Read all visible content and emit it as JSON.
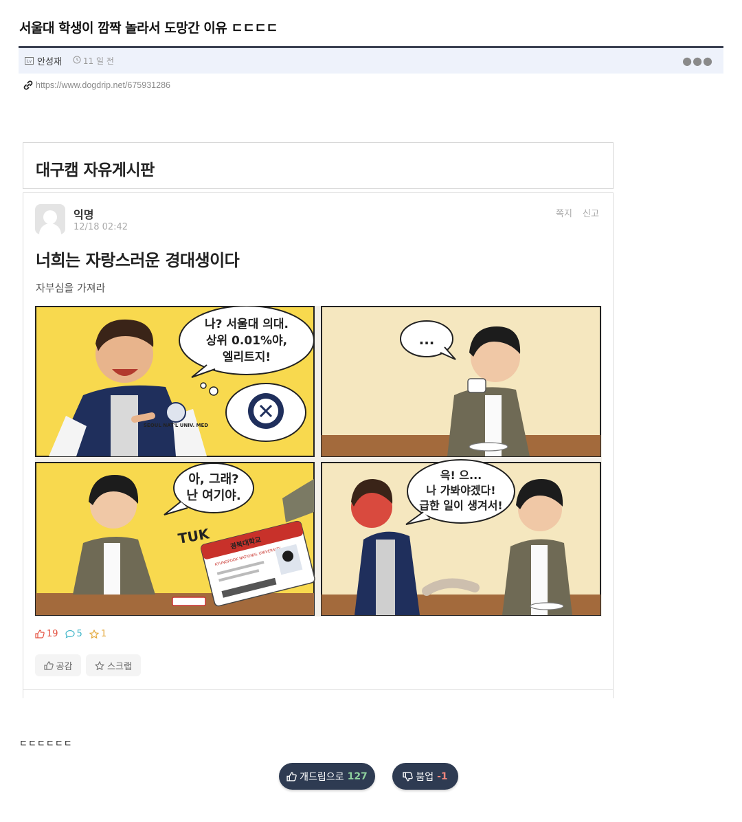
{
  "post": {
    "title": "서울대 학생이 깜짝 놀라서 도망간 이유 ㄷㄷㄷㄷ",
    "level_badge": "Lv",
    "author": "안성재",
    "time": "11 일 전",
    "url": "https://www.dogdrip.net/675931286"
  },
  "embedded": {
    "board_name": "대구캠 자유게시판",
    "nickname": "익명",
    "date": "12/18 02:42",
    "msg_label": "쪽지",
    "report_label": "신고",
    "title": "너희는 자랑스러운 경대생이다",
    "body": "자부심을 가져라",
    "comic": {
      "panel1_lines": [
        "나? 서울대 의대.",
        "상위 0.01%야,",
        "엘리트지!"
      ],
      "panel1_jacket": "SEOUL NAT'L UNIV. MED",
      "panel2_bubble": "...",
      "panel3_lines": [
        "아, 그래?",
        "난 여기야."
      ],
      "panel3_sfx": "TUK",
      "panel3_card_school": "경북대학교",
      "panel3_card_school_en": "KYUNGPOOK NATIONAL UNIVERSITY",
      "panel4_lines": [
        "윽! 으...",
        "나 가봐야겠다!",
        "급한 일이 생겨서!"
      ]
    },
    "stats": {
      "likes": "19",
      "comments": "5",
      "scraps": "1"
    },
    "like_button": "공감",
    "scrap_button": "스크랩"
  },
  "comment_text": "ㄷㄷㄷㄷㄷㄷ",
  "vote": {
    "up_label": "개드립으로",
    "up_count": "127",
    "down_label": "붐업",
    "down_count": "-1"
  },
  "colors": {
    "title_rule": "#3b4152",
    "meta_bg": "#eef2fb",
    "vote_bg": "#2e3b52",
    "like": "#e4503f",
    "comment": "#3fb5c8",
    "scrap": "#e4a93c",
    "panel_yellow": "#f8d94e",
    "panel_cream": "#f5e7bf"
  }
}
